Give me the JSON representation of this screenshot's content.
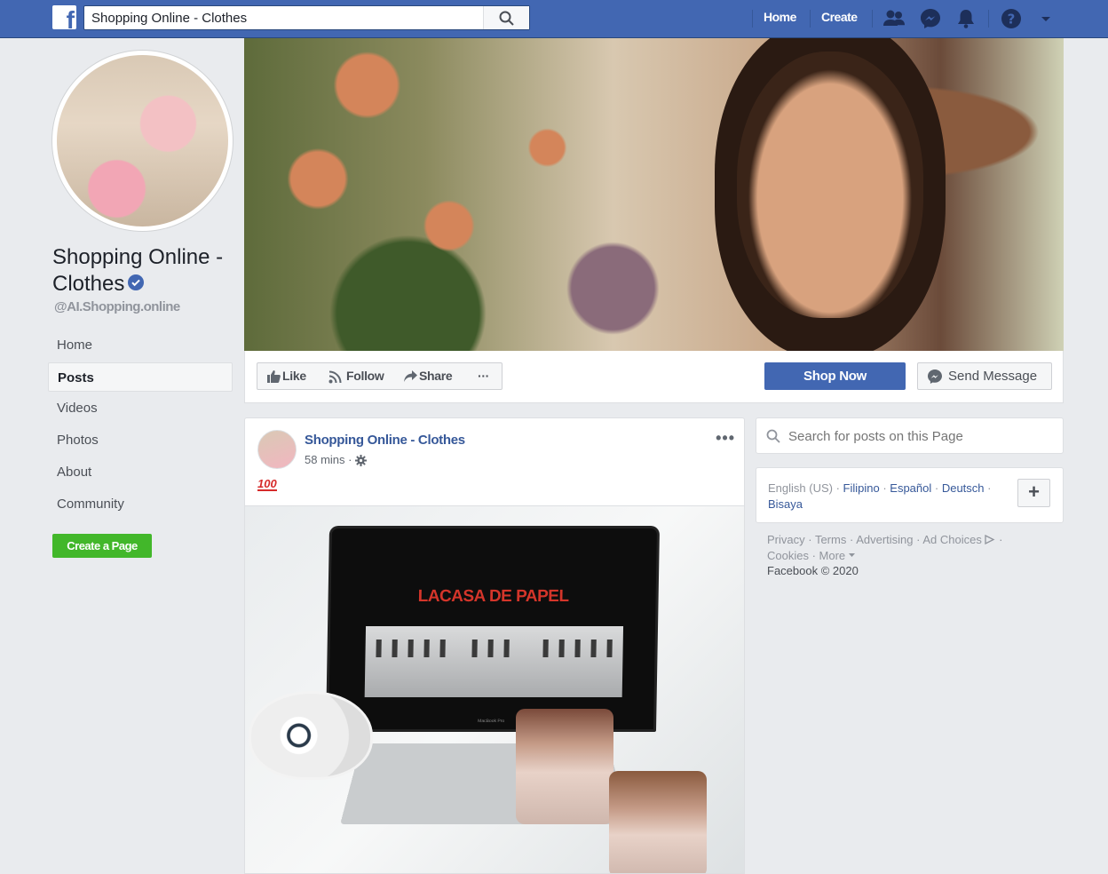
{
  "topbar": {
    "logo_letter": "f",
    "search_value": "Shopping Online - Clothes",
    "nav": {
      "home": "Home",
      "create": "Create"
    },
    "icons": [
      "friends-icon",
      "messenger-icon",
      "notifications-icon",
      "help-icon",
      "account-menu-icon"
    ]
  },
  "profile": {
    "name": "Shopping Online - Clothes",
    "handle": "@AI.Shopping.online",
    "verified": true
  },
  "side_nav": {
    "items": [
      {
        "label": "Home"
      },
      {
        "label": "Posts",
        "active": true
      },
      {
        "label": "Videos"
      },
      {
        "label": "Photos"
      },
      {
        "label": "About"
      },
      {
        "label": "Community"
      }
    ],
    "create_page": "Create a Page"
  },
  "actions": {
    "like": "Like",
    "follow": "Follow",
    "share": "Share",
    "more": "···",
    "shop_now": "Shop Now",
    "send_message": "Send Message"
  },
  "post": {
    "author": "Shopping Online - Clothes",
    "time": "58 mins ·",
    "menu": "•••",
    "emoji": "100",
    "image": {
      "screen_title": "LACASA DE PAPEL",
      "laptop_brand": "MacBook Pro"
    }
  },
  "right": {
    "search_placeholder": "Search for posts on this Page",
    "languages": {
      "current": "English (US)",
      "others": [
        "Filipino",
        "Español",
        "Deutsch",
        "Bisaya"
      ]
    },
    "lang_add": "+",
    "footer": {
      "links": [
        "Privacy",
        "Terms",
        "Advertising",
        "Ad Choices",
        "Cookies",
        "More"
      ],
      "copyright": "Facebook © 2020"
    }
  },
  "colors": {
    "brand_blue": "#4267b2",
    "link_blue": "#365899",
    "green": "#42b72a",
    "page_bg": "#e9ebee"
  }
}
